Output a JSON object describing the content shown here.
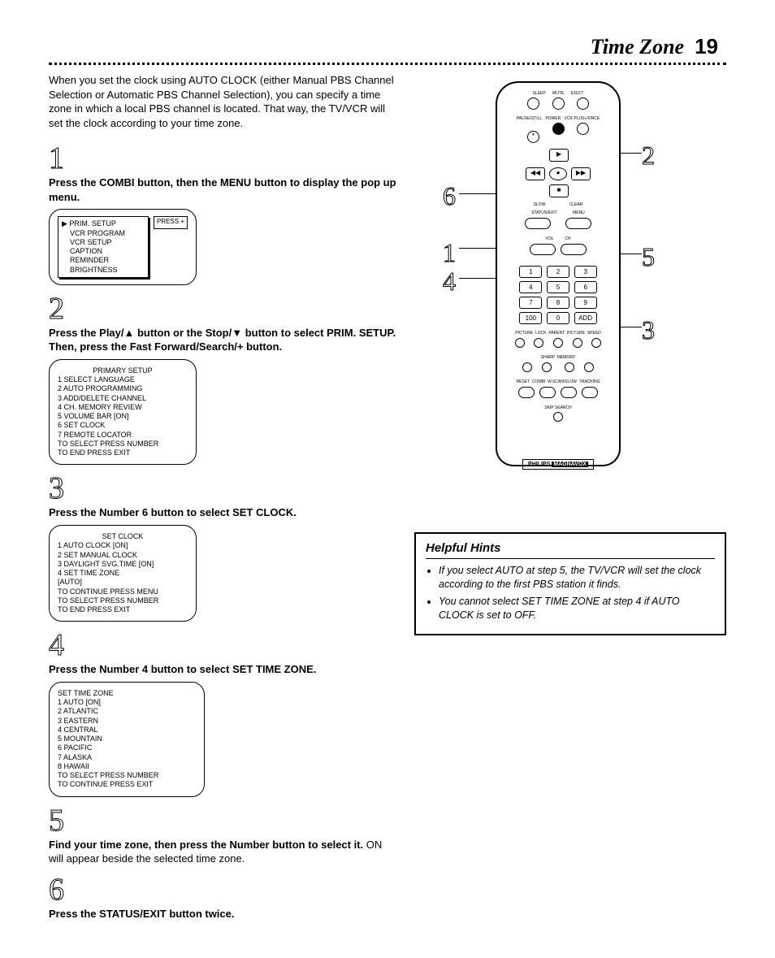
{
  "page": {
    "title": "Time Zone",
    "number": "19"
  },
  "intro": "When you set the clock using AUTO CLOCK (either Manual PBS Channel Selection or Automatic PBS Channel Selection), you can specify a time zone in which a local PBS channel is located. That way, the TV/VCR will set the clock according to your time zone.",
  "steps": {
    "s1": {
      "num": "1",
      "text_a": "Press the ",
      "text_b": "COMBI",
      "text_c": " button, then the ",
      "text_d": "MENU",
      "text_e": " button  to display the pop up menu."
    },
    "s2": {
      "num": "2",
      "text_a": "Press the Play/▲ button or the Stop/▼ button to select PRIM. SETUP. Then, press the Fast Forward/Search/+ button."
    },
    "s3": {
      "num": "3",
      "text_a": "Press the Number 6 button to select SET CLOCK."
    },
    "s4": {
      "num": "4",
      "text_a": "Press the Number 4 button to select SET TIME ZONE."
    },
    "s5": {
      "num": "5",
      "text_a": "Find your time zone, then press the Number button to select it.",
      "text_b": " ON will appear beside the selected time zone."
    },
    "s6": {
      "num": "6",
      "text_a": "Press the STATUS/EXIT button twice."
    }
  },
  "osd1": {
    "press": "PRESS +",
    "l1": "▶ PRIM. SETUP",
    "l2": "VCR PROGRAM",
    "l3": "VCR SETUP",
    "l4": "CAPTION",
    "l5": "REMINDER",
    "l6": "BRIGHTNESS"
  },
  "osd2": {
    "head": "PRIMARY SETUP",
    "l1": "1 SELECT LANGUAGE",
    "l2": "2 AUTO PROGRAMMING",
    "l3": "3 ADD/DELETE CHANNEL",
    "l4": "4 CH. MEMORY REVIEW",
    "l5": "5 VOLUME BAR        [ON]",
    "l6": "6 SET CLOCK",
    "l7": "7 REMOTE LOCATOR",
    "f1": "TO SELECT PRESS NUMBER",
    "f2": "TO END PRESS EXIT"
  },
  "osd3": {
    "head": "SET CLOCK",
    "l1": "1 AUTO CLOCK        [ON]",
    "l2": "2 SET MANUAL CLOCK",
    "l3": "3 DAYLIGHT SVG.TIME [ON]",
    "l4": "4 SET TIME ZONE",
    "l5": "   [AUTO]",
    "f1": "TO CONTINUE PRESS MENU",
    "f2": "TO SELECT PRESS NUMBER",
    "f3": "TO END PRESS EXIT"
  },
  "osd4": {
    "head": "SET TIME ZONE",
    "l1": "1 AUTO              [ON]",
    "l2": "2 ATLANTIC",
    "l3": "3 EASTERN",
    "l4": "4 CENTRAL",
    "l5": "5 MOUNTAIN",
    "l6": "6 PACIFIC",
    "l7": "7 ALASKA",
    "l8": "8 HAWAII",
    "f1": "TO SELECT PRESS NUMBER",
    "f2": "TO CONTINUE PRESS EXIT"
  },
  "remote": {
    "top": {
      "sleep": "SLEEP",
      "mute": "MUTE",
      "eject": "EJECT"
    },
    "row2": {
      "pause": "PAUSE/STILL",
      "power": "POWER",
      "vcrplus": "VCR PLUS+/ONCE"
    },
    "row3": {
      "slow": "SLOW",
      "clear": "CLEAR"
    },
    "row4": {
      "status": "STATUS/EXIT",
      "menu": "MENU"
    },
    "row5": {
      "vol": "VOL",
      "ch": "CH"
    },
    "keys": {
      "k1": "1",
      "k2": "2",
      "k3": "3",
      "k4": "4",
      "k5": "5",
      "k6": "6",
      "k7": "7",
      "k8": "8",
      "k9": "9",
      "k100": "100",
      "k0": "0",
      "kadd": "ADD"
    },
    "row6": {
      "a": "PICTURE",
      "b": "LOCK",
      "c": "PARENT",
      "d": "PICTURE",
      "e": "SPEED"
    },
    "row7": {
      "a": "SHARP",
      "b": "MEMORY"
    },
    "row8": {
      "a": "RESET",
      "b": "COMBI",
      "c": "W.SCAN/SLOW",
      "d": "TRACKING"
    },
    "row9": {
      "a": "SKIP SEARCH"
    },
    "brand": "PHILIPS",
    "brand2": "MAGNAVOX"
  },
  "callouts": {
    "c1": "1",
    "c2": "2",
    "c3": "3",
    "c4": "4",
    "c5": "5",
    "c6": "6"
  },
  "hints": {
    "title": "Helpful Hints",
    "h1": "If you select AUTO at step 5, the TV/VCR will set the clock according to the first PBS station it finds.",
    "h2": "You cannot select SET TIME ZONE at step 4 if AUTO CLOCK is set to OFF."
  }
}
